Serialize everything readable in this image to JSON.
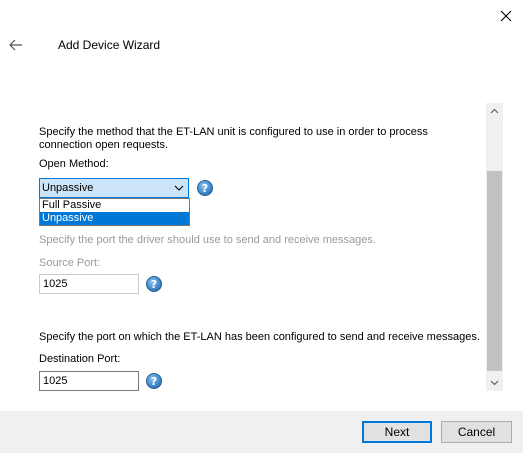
{
  "window": {
    "title": "Add Device Wizard"
  },
  "open_method": {
    "description": "Specify the method that the ET-LAN unit is configured to use in order to process connection open requests.",
    "label": "Open Method:",
    "selected": "Unpassive",
    "options": [
      "Full Passive",
      "Unpassive"
    ]
  },
  "source_port": {
    "description": "Specify the port the driver should use to send and receive messages.",
    "label": "Source Port:",
    "value": "1025"
  },
  "destination_port": {
    "description": "Specify the port on which the ET-LAN has been configured to send and receive messages.",
    "label": "Destination Port:",
    "value": "1025"
  },
  "help_icon": "?",
  "footer": {
    "next_label": "Next",
    "cancel_label": "Cancel"
  },
  "colors": {
    "accent": "#0078d7",
    "selection_bg": "#cce4f7",
    "footer_bg": "#f0f0f0"
  }
}
